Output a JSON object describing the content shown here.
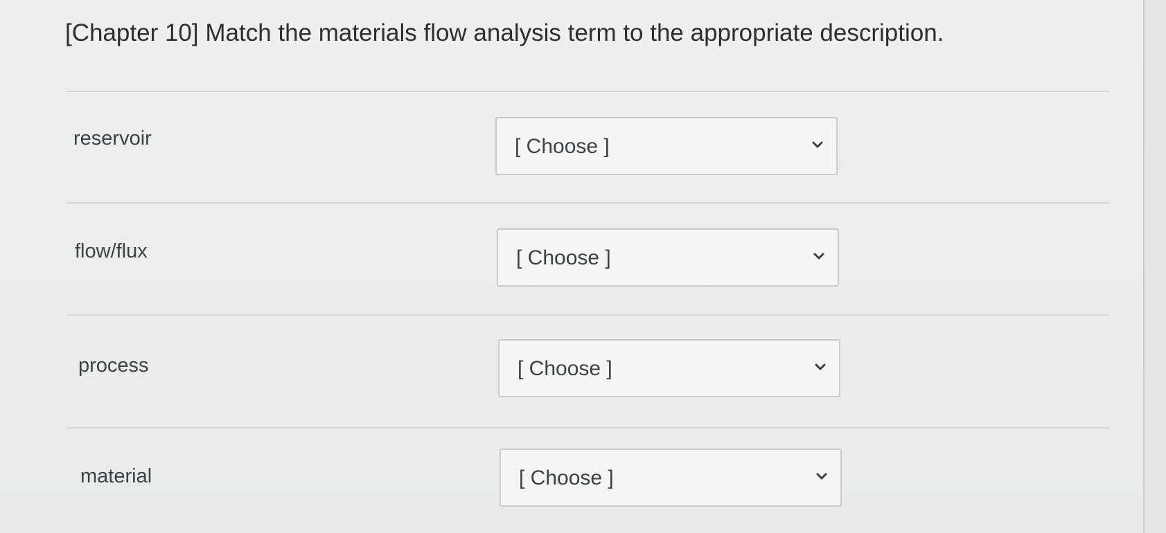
{
  "question": {
    "title": "[Chapter 10] Match the materials flow analysis term to the appropriate description."
  },
  "matches": [
    {
      "term": "reservoir",
      "selected": "[ Choose ]"
    },
    {
      "term": "flow/flux",
      "selected": "[ Choose ]"
    },
    {
      "term": "process",
      "selected": "[ Choose ]"
    },
    {
      "term": "material",
      "selected": "[ Choose ]"
    }
  ],
  "icons": {
    "dropdown": "chevron-down-icon"
  },
  "colors": {
    "text": "#2b2f31",
    "border": "#c7cbc9",
    "background": "#e9ecea"
  }
}
